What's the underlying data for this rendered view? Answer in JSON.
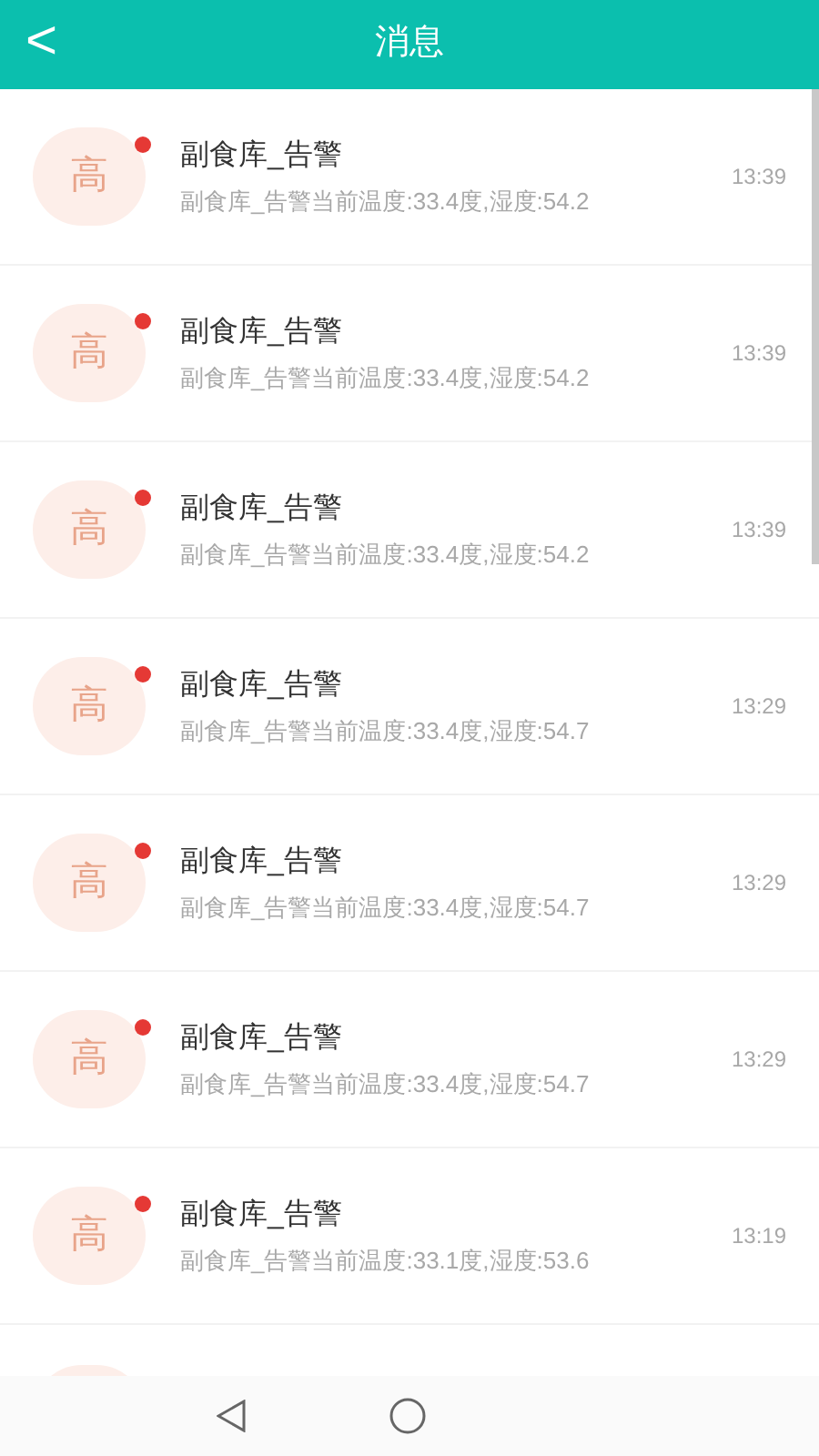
{
  "header": {
    "back": "<",
    "title": "消息"
  },
  "messages": [
    {
      "avatar": "高",
      "unread": true,
      "title": "副食库_告警",
      "body": "副食库_告警当前温度:33.4度,湿度:54.2",
      "time": "13:39"
    },
    {
      "avatar": "高",
      "unread": true,
      "title": "副食库_告警",
      "body": "副食库_告警当前温度:33.4度,湿度:54.2",
      "time": "13:39"
    },
    {
      "avatar": "高",
      "unread": true,
      "title": "副食库_告警",
      "body": "副食库_告警当前温度:33.4度,湿度:54.2",
      "time": "13:39"
    },
    {
      "avatar": "高",
      "unread": true,
      "title": "副食库_告警",
      "body": "副食库_告警当前温度:33.4度,湿度:54.7",
      "time": "13:29"
    },
    {
      "avatar": "高",
      "unread": true,
      "title": "副食库_告警",
      "body": "副食库_告警当前温度:33.4度,湿度:54.7",
      "time": "13:29"
    },
    {
      "avatar": "高",
      "unread": true,
      "title": "副食库_告警",
      "body": "副食库_告警当前温度:33.4度,湿度:54.7",
      "time": "13:29"
    },
    {
      "avatar": "高",
      "unread": true,
      "title": "副食库_告警",
      "body": "副食库_告警当前温度:33.1度,湿度:53.6",
      "time": "13:19"
    }
  ]
}
